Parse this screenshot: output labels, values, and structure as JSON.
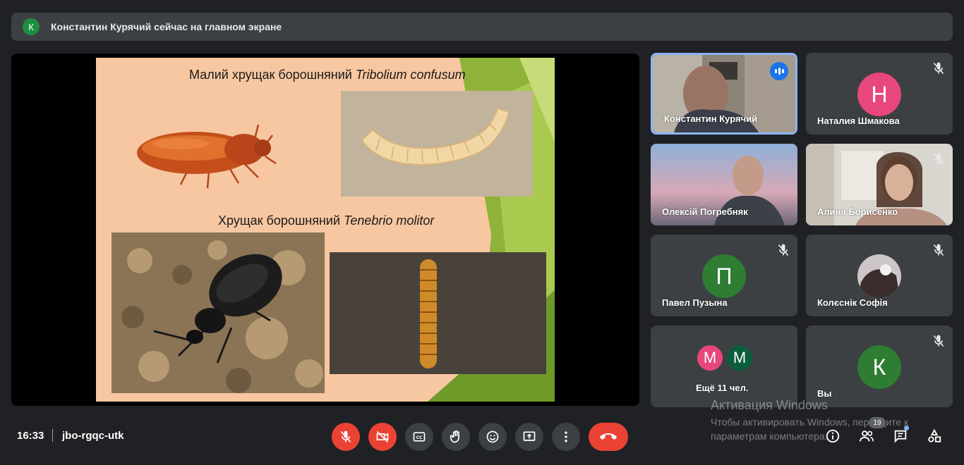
{
  "banner": {
    "avatar_letter": "К",
    "text": "Константин Курячий сейчас на главном экране"
  },
  "slide": {
    "title1_plain": "Малий хрущак борошняний ",
    "title1_italic": "Tribolium confusum",
    "title2_plain": "Хрущак борошняний ",
    "title2_italic": "Tenebrio molitor"
  },
  "participants": [
    {
      "name": "Константин Курячий",
      "speaking": true
    },
    {
      "name": "Наталия Шмакова",
      "letter": "Н",
      "color": "#e8477b",
      "muted": true
    },
    {
      "name": "Олексій Погребняк"
    },
    {
      "name": "Алина Борисенко",
      "muted": true
    },
    {
      "name": "Павел Пузына",
      "letter": "П",
      "color": "#2e7d32",
      "muted": true
    },
    {
      "name": "Колєснік Софія",
      "muted": true
    },
    {
      "name": "Ещё 11 чел.",
      "letters": [
        "М",
        "М"
      ],
      "colors": [
        "#e8477b",
        "#0b5e3c"
      ]
    },
    {
      "name": "Вы",
      "letter": "К",
      "color": "#2e7d32",
      "muted": true
    }
  ],
  "bottom": {
    "time": "16:33",
    "meeting_code": "jbo-rgqc-utk",
    "people_count": "19"
  },
  "watermark": {
    "title": "Активация Windows",
    "subtitle": "Чтобы активировать Windows, перейдите к параметрам компьютера."
  }
}
